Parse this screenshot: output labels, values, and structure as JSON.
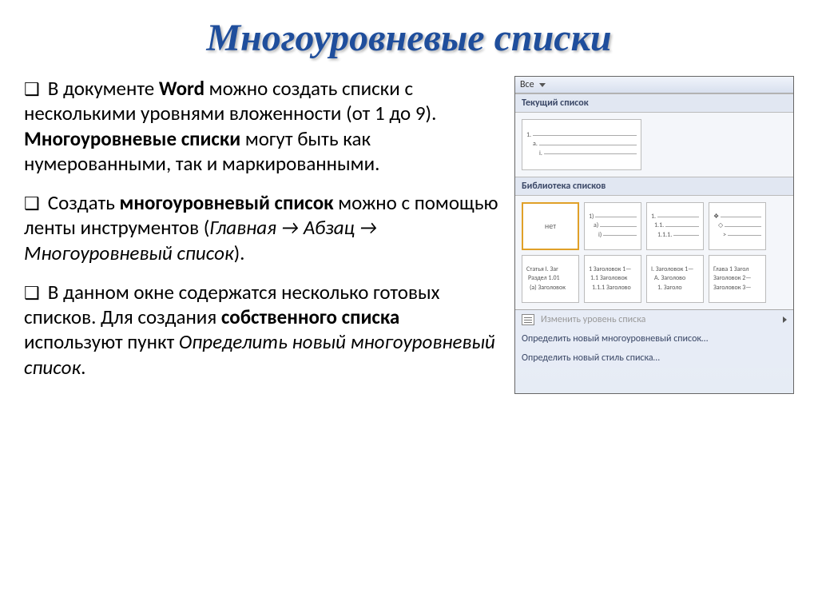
{
  "title": "Многоуровневые списки",
  "p1": {
    "a": "В документе ",
    "b": "Word",
    "c": " можно создать списки с несколькими уровнями вложенности (от 1 до 9). ",
    "d": "Многоуровневые списки",
    "e": " могут быть как нумерованными, так и маркированными."
  },
  "p2": {
    "a": "Создать ",
    "b": "многоуровневый список",
    "c": " можно с помощью  ленты инструментов (",
    "d": "Главная → Абзац → Многоуровневый список",
    "e": ")."
  },
  "p3": {
    "a": "В данном окне содержатся несколько готовых списков.  Для создания ",
    "b": "собственного списка",
    "c": " используют пункт ",
    "d": "Определить новый многоуровневый список",
    "e": "."
  },
  "panel": {
    "topLabel": "Все",
    "section1": "Текущий список",
    "current": {
      "l1": "1.",
      "l2": "a.",
      "l3": "i."
    },
    "section2": "Библиотека списков",
    "opts": {
      "none": "нет",
      "b": {
        "l1": "1)",
        "l2": "a)",
        "l3": "i)"
      },
      "c": {
        "l1": "1.",
        "l2": "1.1.",
        "l3": "1.1.1."
      },
      "d": {
        "l1": "❖",
        "l2": "◇",
        "l3": ">"
      },
      "e": {
        "l1": "Статья I. Заг",
        "l2": "Раздел 1.01",
        "l3": "(a) Заголовок"
      },
      "f": {
        "l1": "1 Заголовок 1—",
        "l2": "1.1 Заголовок",
        "l3": "1.1.1 Заголово"
      },
      "g": {
        "l1": "I. Заголовок 1—",
        "l2": "A. Заголово",
        "l3": "1. Заголо"
      },
      "h": {
        "l1": "Глава 1 Загол",
        "l2": "Заголовок 2—",
        "l3": "Заголовок 3—"
      }
    },
    "footer": {
      "changeLevel": "Изменить уровень списка",
      "defineNew": "Определить новый многоуровневый список…",
      "defineStyle": "Определить новый стиль списка…"
    }
  }
}
